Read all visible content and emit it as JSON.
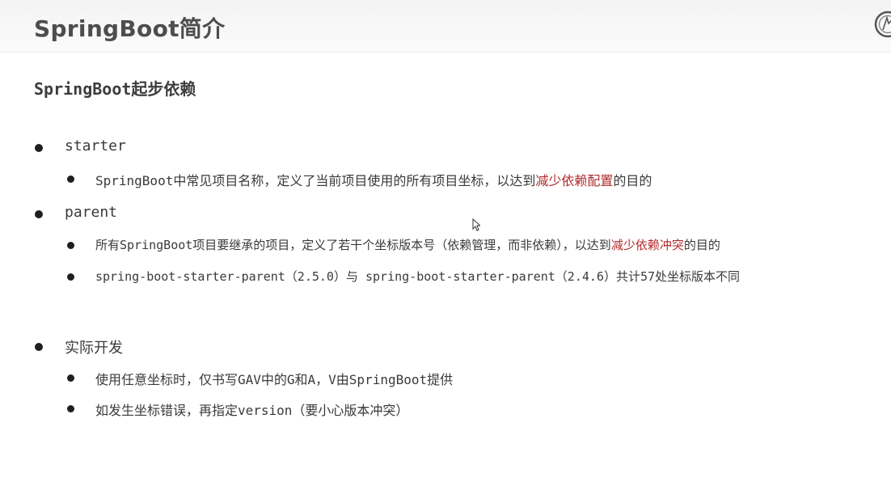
{
  "header": {
    "title": "SpringBoot简介",
    "logo_icon": "circular-logo-icon"
  },
  "subtitle": "SpringBoot起步依赖",
  "bullets": [
    {
      "label": "starter",
      "children": [
        {
          "before": "SpringBoot中常见项目名称，定义了当前项目使用的所有项目坐标，以达到",
          "highlight": "减少依赖配置",
          "after": "的目的"
        }
      ]
    },
    {
      "label": "parent",
      "children": [
        {
          "before": "所有SpringBoot项目要继承的项目，定义了若干个坐标版本号（依赖管理，而非依赖），以达到",
          "highlight": "减少依赖冲突",
          "after": "的目的"
        },
        {
          "text": "spring-boot-starter-parent（2.5.0）与 spring-boot-starter-parent（2.4.6）共计57处坐标版本不同"
        }
      ]
    },
    {
      "label": "实际开发",
      "children": [
        {
          "text": "使用任意坐标时，仅书写GAV中的G和A，V由SpringBoot提供"
        },
        {
          "text": "如发生坐标错误，再指定version（要小心版本冲突）"
        }
      ]
    }
  ],
  "colors": {
    "highlight": "#b02a2a",
    "title": "#4d4d4d",
    "bullet": "#1f1f1f"
  }
}
